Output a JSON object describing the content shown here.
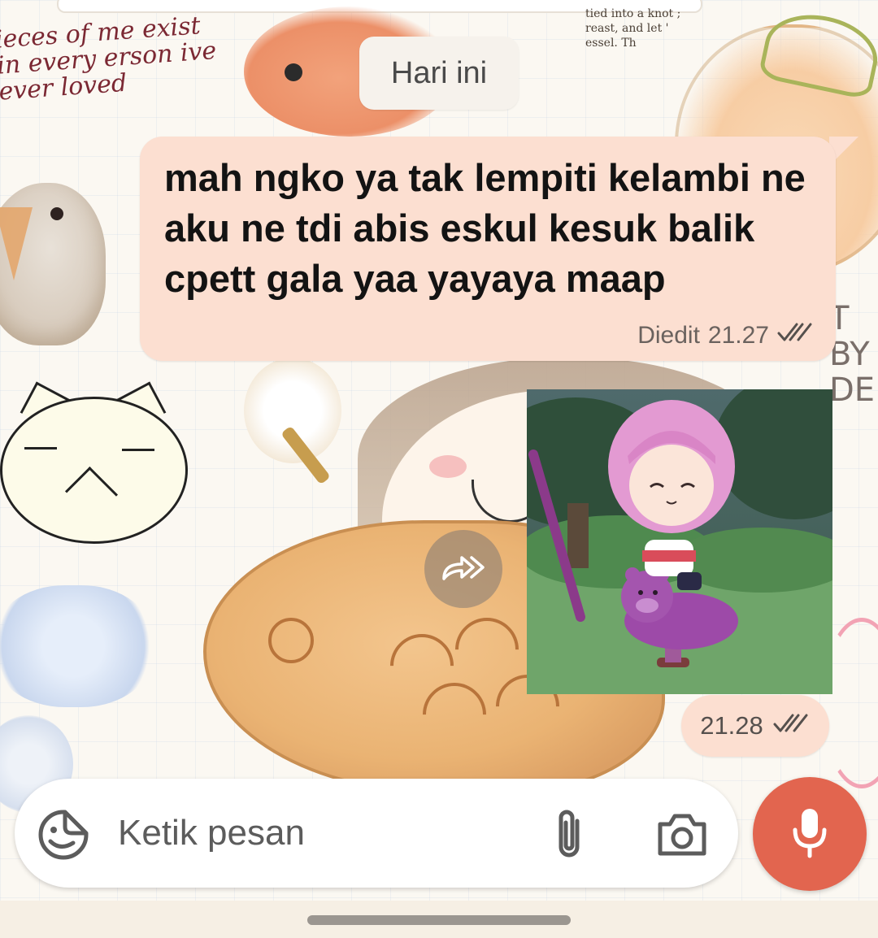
{
  "wallpaper": {
    "handwriting": "ieces of me exist in every erson ive ever loved",
    "text_scrap": "tied into a knot ; reast, and let ' essel. Th",
    "side_text": "T BY DE"
  },
  "chat": {
    "date_label": "Hari ini",
    "messages": [
      {
        "text": "mah ngko ya tak lempiti kelambi ne aku ne tdi abis eskul kesuk balik cpett gala yaa yayaya maap",
        "edited_label": "Diedit",
        "time": "21.27",
        "status": "read"
      },
      {
        "type": "image",
        "image_desc": "pink-haired chibi character riding a purple bear spring rider",
        "time": "21.28",
        "status": "read"
      }
    ]
  },
  "composer": {
    "placeholder": "Ketik pesan"
  },
  "icons": {
    "sticker": "sticker-icon",
    "attach": "paperclip-icon",
    "camera": "camera-icon",
    "mic": "microphone-icon",
    "forward": "forward-icon",
    "ticks": "double-check-icon"
  },
  "colors": {
    "bubble": "#fcdfd1",
    "mic_button": "#e2654f",
    "date_chip": "#f6f2ec"
  }
}
